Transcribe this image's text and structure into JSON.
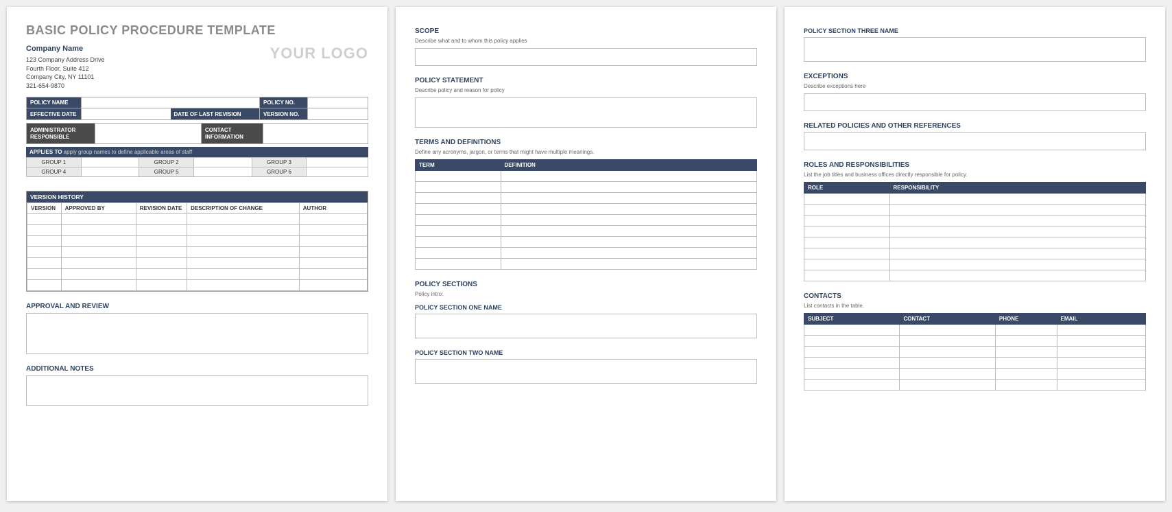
{
  "page1": {
    "title": "BASIC POLICY PROCEDURE TEMPLATE",
    "company_name": "Company Name",
    "addr1": "123 Company Address Drive",
    "addr2": "Fourth Floor, Suite 412",
    "addr3": "Company City, NY  11101",
    "phone": "321-654-9870",
    "logo": "YOUR LOGO",
    "labels": {
      "policy_name": "POLICY NAME",
      "policy_no": "POLICY NO.",
      "effective_date": "EFFECTIVE DATE",
      "date_last_rev": "DATE OF LAST REVISION",
      "version_no": "VERSION NO.",
      "admin_resp": "ADMINISTRATOR RESPONSIBLE",
      "contact_info": "CONTACT INFORMATION",
      "applies_to": "APPLIES TO",
      "applies_sub": "apply group names to define applicable areas of staff"
    },
    "groups": [
      "GROUP 1",
      "GROUP 2",
      "GROUP 3",
      "GROUP 4",
      "GROUP 5",
      "GROUP 6"
    ],
    "version_history": {
      "title": "VERSION HISTORY",
      "cols": [
        "VERSION",
        "APPROVED BY",
        "REVISION DATE",
        "DESCRIPTION OF CHANGE",
        "AUTHOR"
      ]
    },
    "approval_review": "APPROVAL AND REVIEW",
    "additional_notes": "ADDITIONAL NOTES"
  },
  "page2": {
    "scope": "SCOPE",
    "scope_sub": "Describe what and to whom this policy applies",
    "policy_statement": "POLICY STATEMENT",
    "policy_statement_sub": "Describe policy and reason for policy",
    "terms": "TERMS AND DEFINITIONS",
    "terms_sub": "Define any acronyms, jargon, or terms that might have multiple meanings.",
    "terms_cols": [
      "TERM",
      "DEFINITION"
    ],
    "policy_sections": "POLICY SECTIONS",
    "policy_intro": "Policy intro:",
    "sec1": "POLICY SECTION ONE NAME",
    "sec2": "POLICY SECTION TWO NAME"
  },
  "page3": {
    "sec3": "POLICY SECTION THREE NAME",
    "exceptions": "EXCEPTIONS",
    "exceptions_sub": "Describe exceptions here",
    "related": "RELATED POLICIES AND OTHER REFERENCES",
    "roles": "ROLES AND RESPONSIBILITIES",
    "roles_sub": "List the job titles and business offices directly responsible for policy.",
    "roles_cols": [
      "ROLE",
      "RESPONSIBILITY"
    ],
    "contacts": "CONTACTS",
    "contacts_sub": "List contacts in the table.",
    "contacts_cols": [
      "SUBJECT",
      "CONTACT",
      "PHONE",
      "EMAIL"
    ]
  }
}
